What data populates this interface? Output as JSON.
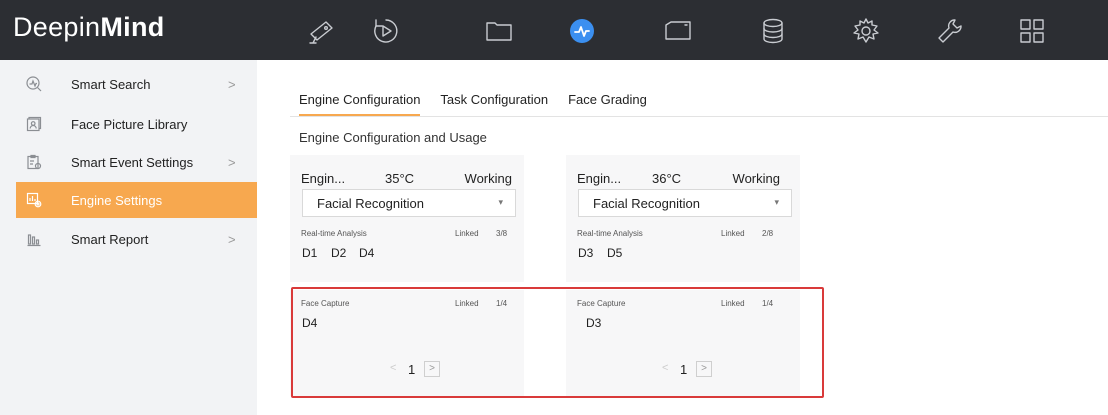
{
  "app": {
    "logo_light": "Deepin",
    "logo_bold": "Mind"
  },
  "topnav": {
    "icons": [
      "camera-icon",
      "playback-icon",
      "folder-icon",
      "smart-analysis-icon",
      "display-icon",
      "storage-icon",
      "settings-icon",
      "maintenance-icon",
      "grid-icon"
    ],
    "active_icon": "smart-analysis-icon",
    "accent": "#3b8ff0"
  },
  "sidebar": {
    "items": [
      {
        "label": "Smart Search",
        "icon": "smart-search-icon",
        "chevron": ">"
      },
      {
        "label": "Face Picture Library",
        "icon": "face-library-icon",
        "chevron": ""
      },
      {
        "label": "Smart Event Settings",
        "icon": "event-settings-icon",
        "chevron": ">"
      },
      {
        "label": "Engine Settings",
        "icon": "engine-settings-icon",
        "chevron": ""
      },
      {
        "label": "Smart Report",
        "icon": "report-icon",
        "chevron": ">"
      }
    ],
    "active_color": "#f7a84f"
  },
  "tabs": [
    {
      "label": "Engine Configuration",
      "active": true
    },
    {
      "label": "Task Configuration",
      "active": false
    },
    {
      "label": "Face Grading",
      "active": false
    }
  ],
  "section_title": "Engine Configuration and Usage",
  "engines": [
    {
      "name": "Engin...",
      "temp": "35°C",
      "status": "Working",
      "mode": "Facial Recognition",
      "realtime": {
        "label": "Real-time Analysis",
        "linked_label": "Linked",
        "linked": "3/8",
        "devices": [
          "D1",
          "D2",
          "D4"
        ]
      },
      "capture": {
        "label": "Face Capture",
        "linked_label": "Linked",
        "linked": "1/4",
        "devices": [
          "D4"
        ]
      },
      "page": "1"
    },
    {
      "name": "Engin...",
      "temp": "36°C",
      "status": "Working",
      "mode": "Facial Recognition",
      "realtime": {
        "label": "Real-time Analysis",
        "linked_label": "Linked",
        "linked": "2/8",
        "devices": [
          "D3",
          "D5"
        ]
      },
      "capture": {
        "label": "Face Capture",
        "linked_label": "Linked",
        "linked": "1/4",
        "devices": [
          "D3"
        ]
      },
      "page": "1"
    }
  ],
  "pager": {
    "prev": "<",
    "next": ">"
  },
  "highlight_color": "#d93a3a"
}
